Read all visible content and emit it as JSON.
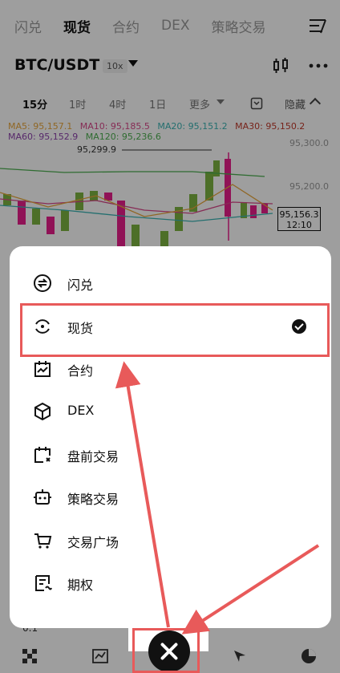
{
  "top_tabs": [
    "闪兑",
    "现货",
    "合约",
    "DEX",
    "策略交易"
  ],
  "active_top_tab": 1,
  "pair": {
    "name": "BTC/USDT",
    "leverage": "10x"
  },
  "timeframes": [
    "15分",
    "1时",
    "4时",
    "1日",
    "更多"
  ],
  "hide_label": "隐藏",
  "ma_line1": [
    "MA5: 95,157.1",
    "MA10: 95,185.5",
    "MA20: 95,151.2",
    "MA30: 95,150.2"
  ],
  "ma_line2": [
    "MA60: 95,152.9",
    "MA120: 95,236.6"
  ],
  "colors": {
    "ma5": "#e8a63c",
    "ma10": "#d9488a",
    "ma20": "#3bb3b3",
    "ma30": "#c0392b",
    "ma60": "#8e44ad",
    "ma120": "#4caf50",
    "up": "#7cb342",
    "down": "#e91e8c",
    "accent_red": "#e85a5a"
  },
  "axis": {
    "p1": "95,300.0",
    "p2": "95,200.0"
  },
  "max_price": "95,299.9",
  "price_tag": {
    "price": "95,156.3",
    "time": "12:10"
  },
  "bottom_left": "0.1",
  "menu_items": [
    {
      "label": "闪兑",
      "icon": "swap-circle-icon"
    },
    {
      "label": "现货",
      "icon": "refresh-circle-icon",
      "selected": true
    },
    {
      "label": "合约",
      "icon": "contract-calendar-icon"
    },
    {
      "label": "DEX",
      "icon": "cube-icon"
    },
    {
      "label": "盘前交易",
      "icon": "premarket-calendar-icon"
    },
    {
      "label": "策略交易",
      "icon": "bot-icon"
    },
    {
      "label": "交易广场",
      "icon": "cart-icon"
    },
    {
      "label": "期权",
      "icon": "options-doc-icon"
    }
  ]
}
